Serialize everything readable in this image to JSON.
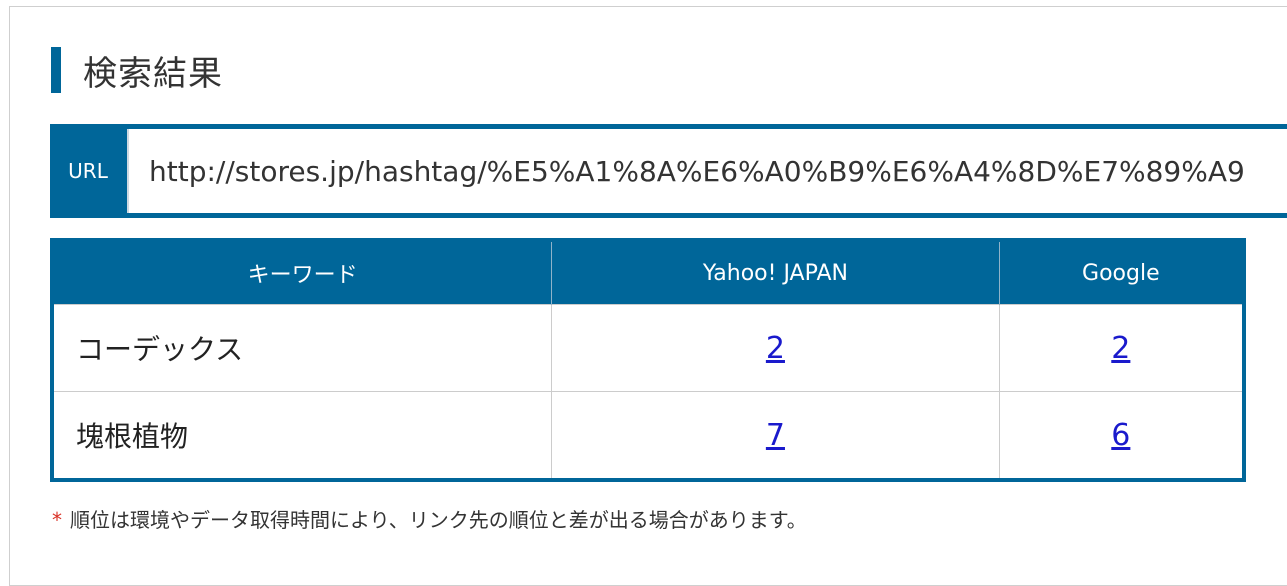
{
  "heading": {
    "title": "検索結果"
  },
  "url_box": {
    "label": "URL",
    "value": "http://stores.jp/hashtag/%E5%A1%8A%E6%A0%B9%E6%A4%8D%E7%89%A9"
  },
  "table": {
    "headers": [
      "キーワード",
      "Yahoo! JAPAN",
      "Google"
    ],
    "rows": [
      {
        "keyword": "コーデックス",
        "yahoo": "2",
        "google": "2"
      },
      {
        "keyword": "塊根植物",
        "yahoo": "7",
        "google": "6"
      }
    ]
  },
  "note": {
    "mark": "*",
    "text": "順位は環境やデータ取得時間により、リンク先の順位と差が出る場合があります。"
  },
  "colors": {
    "accent": "#006699",
    "link": "#1a1acc",
    "note_mark": "#d93025"
  }
}
